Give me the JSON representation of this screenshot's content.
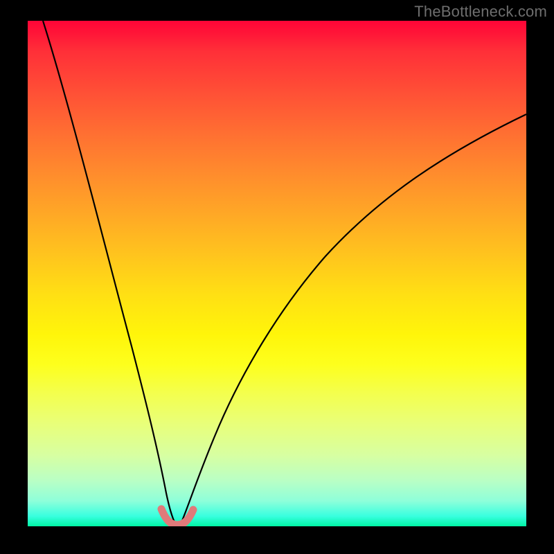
{
  "watermark": "TheBottleneck.com",
  "colors": {
    "page_bg": "#000000",
    "watermark": "#6e6e6e",
    "curve": "#000000",
    "marker": "#e07a7a",
    "gradient_top": "#ff0437",
    "gradient_bottom": "#00f5a5"
  },
  "chart_data": {
    "type": "line",
    "title": "",
    "xlabel": "",
    "ylabel": "",
    "xlim": [
      0,
      100
    ],
    "ylim": [
      0,
      100
    ],
    "grid": false,
    "legend": false,
    "x": [
      0,
      4,
      8,
      12,
      16,
      20,
      23,
      25,
      27,
      28.5,
      30,
      31.5,
      33,
      36,
      40,
      45,
      50,
      55,
      60,
      65,
      70,
      75,
      80,
      85,
      90,
      95,
      100
    ],
    "series": [
      {
        "name": "bottleneck-curve",
        "values": [
          100,
          89,
          78,
          66,
          54,
          40,
          26,
          12,
          2,
          0,
          0,
          2,
          7,
          16,
          26,
          36,
          44,
          51,
          57,
          62,
          66,
          70,
          73,
          76,
          78.5,
          80.5,
          82
        ]
      }
    ],
    "highlight": {
      "name": "minimum-region",
      "x": [
        26.5,
        28,
        29.5,
        31,
        32.5
      ],
      "y": [
        3,
        0.5,
        0,
        0.5,
        3
      ]
    },
    "gradient_meaning": "red = high bottleneck, green = no bottleneck"
  }
}
